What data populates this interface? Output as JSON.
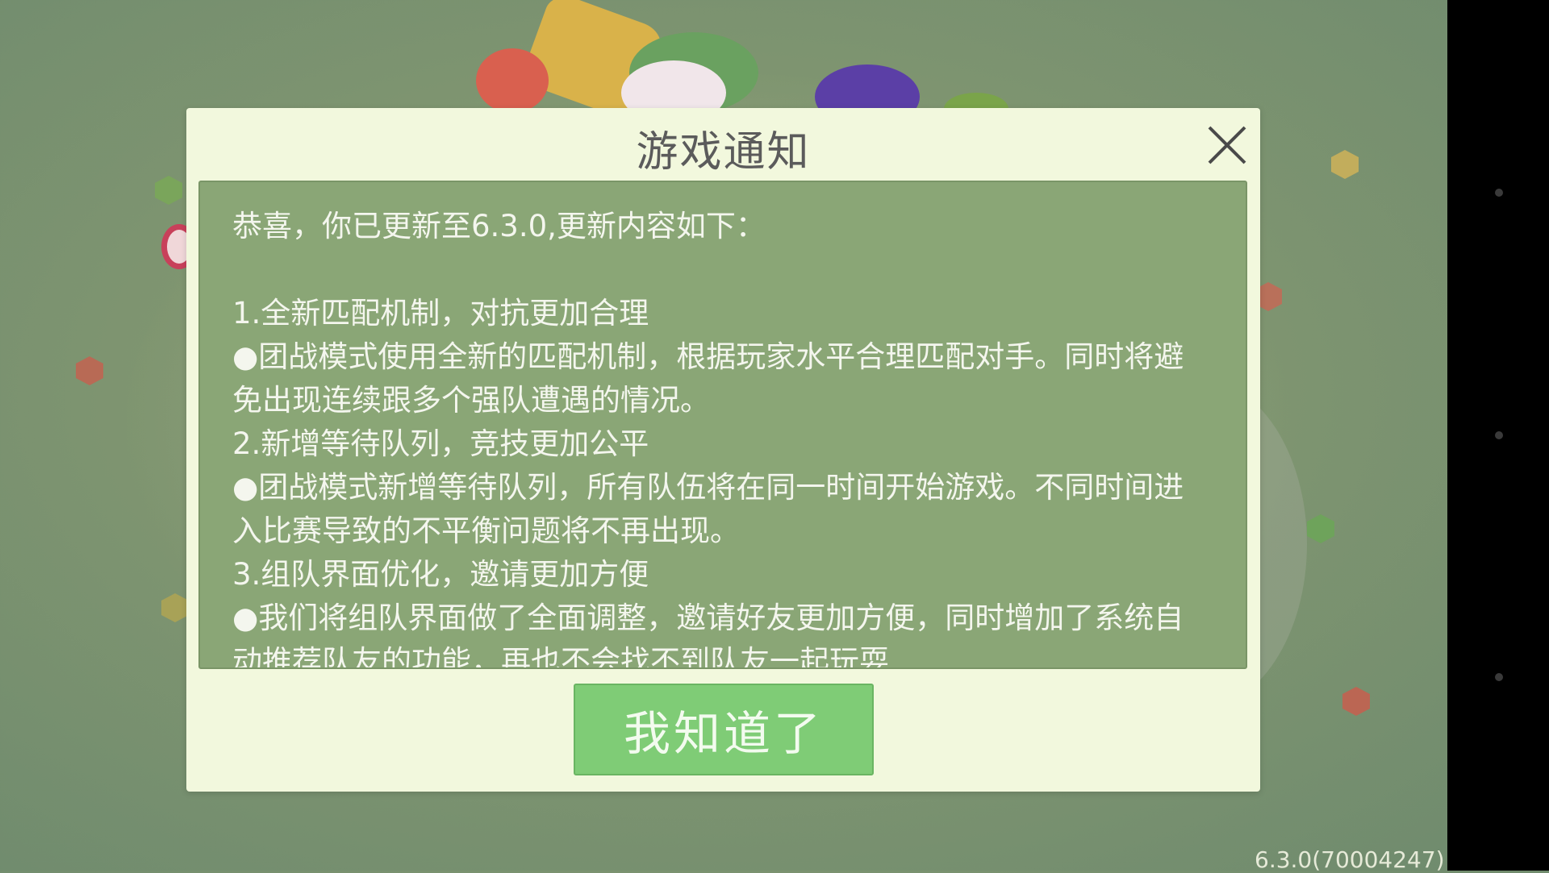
{
  "dialog": {
    "title": "游戏通知",
    "intro": "恭喜，你已更新至6.3.0,更新内容如下：",
    "items": [
      "1.全新匹配机制，对抗更加合理",
      "●团战模式使用全新的匹配机制，根据玩家水平合理匹配对手。同时将避免出现连续跟多个强队遭遇的情况。",
      "2.新增等待队列，竞技更加公平",
      "●团战模式新增等待队列，所有队伍将在同一时间开始游戏。不同时间进入比赛导致的不平衡问题将不再出现。",
      "3.组队界面优化，邀请更加方便",
      "●我们将组队界面做了全面调整，邀请好友更加方便，同时增加了系统自动推荐队友的功能，再也不会找不到队友一起玩耍"
    ],
    "confirm_label": "我知道了",
    "close_icon": "close-icon"
  },
  "footer": {
    "version": "6.3.0(70004247)"
  },
  "colors": {
    "dialog_bg": "#f2f8dd",
    "content_bg": "#8aa676",
    "button_bg": "#7fcc76"
  }
}
